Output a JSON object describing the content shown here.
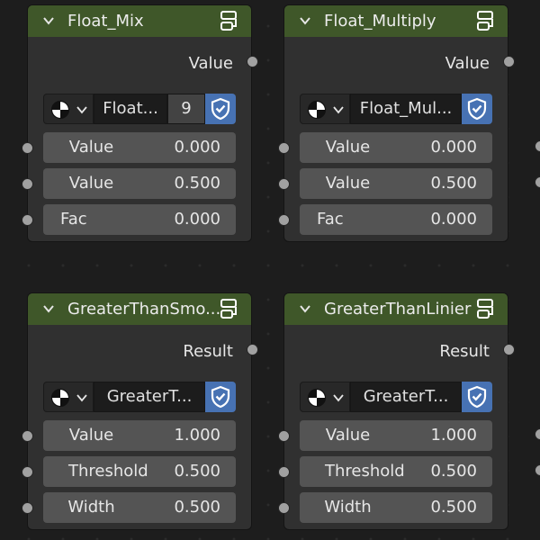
{
  "nodes": [
    {
      "title": "Float_Mix",
      "output": "Value",
      "selector_name": "Float...",
      "selector_count": "9",
      "inputs": [
        {
          "label": "Value",
          "value": "0.000"
        },
        {
          "label": "Value",
          "value": "0.500"
        },
        {
          "label": "Fac",
          "value": "0.000"
        }
      ]
    },
    {
      "title": "Float_Multiply",
      "output": "Value",
      "selector_name": "Float_Mul...",
      "inputs": [
        {
          "label": "Value",
          "value": "0.000"
        },
        {
          "label": "Value",
          "value": "0.500"
        },
        {
          "label": "Fac",
          "value": "0.000"
        }
      ]
    },
    {
      "title": "GreaterThanSmo...",
      "output": "Result",
      "selector_name": "GreaterT...",
      "inputs": [
        {
          "label": "Value",
          "value": "1.000"
        },
        {
          "label": "Threshold",
          "value": "0.500"
        },
        {
          "label": "Width",
          "value": "0.500"
        }
      ]
    },
    {
      "title": "GreaterThanLinier",
      "output": "Result",
      "selector_name": "GreaterT...",
      "inputs": [
        {
          "label": "Value",
          "value": "1.000"
        },
        {
          "label": "Threshold",
          "value": "0.500"
        },
        {
          "label": "Width",
          "value": "0.500"
        }
      ]
    }
  ],
  "colors": {
    "background": "#1d1d1d",
    "node_body": "#303030",
    "node_header": "#3f5729",
    "field": "#545454",
    "shield_button": "#4772b3",
    "socket": "#a1a1a1"
  },
  "icons": [
    "chevron-down-icon",
    "node-group-icon",
    "material-ball-icon",
    "shield-check-icon"
  ]
}
